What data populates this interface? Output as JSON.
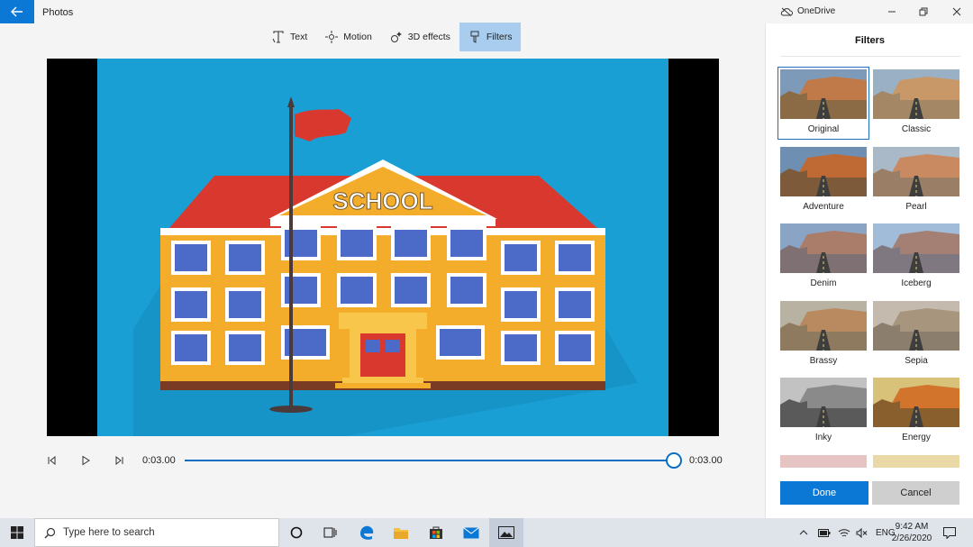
{
  "app": {
    "title": "Photos",
    "back_icon": "arrow-left-icon",
    "onedrive_label": "OneDrive"
  },
  "toolbar": {
    "items": [
      {
        "label": "Text",
        "icon": "text-icon"
      },
      {
        "label": "Motion",
        "icon": "motion-icon"
      },
      {
        "label": "3D effects",
        "icon": "sparkle-icon"
      },
      {
        "label": "Filters",
        "icon": "filter-icon",
        "active": true
      }
    ]
  },
  "video": {
    "sign_text": "SCHOOL"
  },
  "playback": {
    "current_time": "0:03.00",
    "end_time": "0:03.00",
    "progress": 1.0
  },
  "panel": {
    "title": "Filters",
    "filters": [
      {
        "label": "Original",
        "selected": true
      },
      {
        "label": "Classic"
      },
      {
        "label": "Adventure"
      },
      {
        "label": "Pearl"
      },
      {
        "label": "Denim"
      },
      {
        "label": "Iceberg"
      },
      {
        "label": "Brassy"
      },
      {
        "label": "Sepia"
      },
      {
        "label": "Inky"
      },
      {
        "label": "Energy"
      }
    ],
    "done_label": "Done",
    "cancel_label": "Cancel"
  },
  "taskbar": {
    "search_placeholder": "Type here to search",
    "language": "ENG",
    "time": "9:42 AM",
    "date": "2/26/2020"
  },
  "colors": {
    "accent": "#0a78d4",
    "active_tab": "#a9cdef",
    "video_bg": "#1a9fd4"
  }
}
